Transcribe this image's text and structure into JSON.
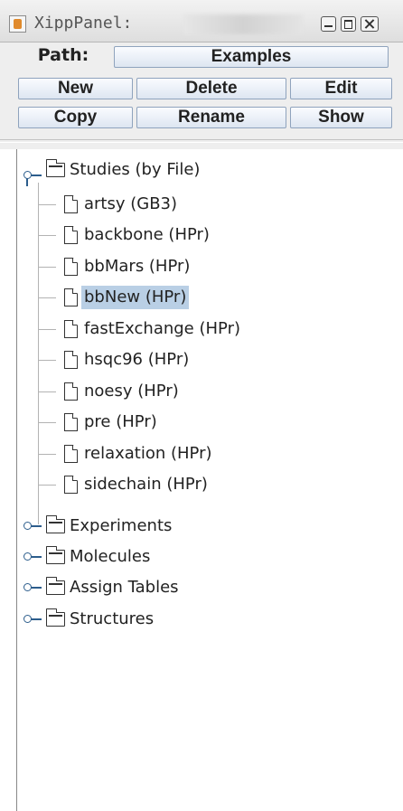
{
  "window": {
    "title": "XippPanel:",
    "title_suffix_obscured": "",
    "icon": "java-app-icon"
  },
  "toolbar": {
    "path_label": "Path:",
    "path_value": "Examples",
    "buttons": {
      "new": "New",
      "delete": "Delete",
      "edit": "Edit",
      "copy": "Copy",
      "rename": "Rename",
      "show": "Show"
    }
  },
  "tree": {
    "root": {
      "label": "Studies (by File)",
      "icon": "folder-icon",
      "expanded": true,
      "children": [
        {
          "label": "artsy (GB3)",
          "icon": "file-icon",
          "selected": false
        },
        {
          "label": "backbone (HPr)",
          "icon": "file-icon",
          "selected": false
        },
        {
          "label": "bbMars (HPr)",
          "icon": "file-icon",
          "selected": false
        },
        {
          "label": "bbNew (HPr)",
          "icon": "file-icon",
          "selected": true
        },
        {
          "label": "fastExchange (HPr)",
          "icon": "file-icon",
          "selected": false
        },
        {
          "label": "hsqc96 (HPr)",
          "icon": "file-icon",
          "selected": false
        },
        {
          "label": "noesy (HPr)",
          "icon": "file-icon",
          "selected": false
        },
        {
          "label": "pre (HPr)",
          "icon": "file-icon",
          "selected": false
        },
        {
          "label": "relaxation (HPr)",
          "icon": "file-icon",
          "selected": false
        },
        {
          "label": "sidechain (HPr)",
          "icon": "file-icon",
          "selected": false
        }
      ]
    },
    "collapsed_folders": [
      {
        "label": "Experiments",
        "icon": "folder-icon",
        "expanded": false
      },
      {
        "label": "Molecules",
        "icon": "folder-icon",
        "expanded": false
      },
      {
        "label": "Assign Tables",
        "icon": "folder-icon",
        "expanded": false
      },
      {
        "label": "Structures",
        "icon": "folder-icon",
        "expanded": false
      }
    ]
  },
  "colors": {
    "selection": "#b9cfe5",
    "button_border": "#8fa3bd",
    "tree_handle": "#2c5d8c"
  }
}
